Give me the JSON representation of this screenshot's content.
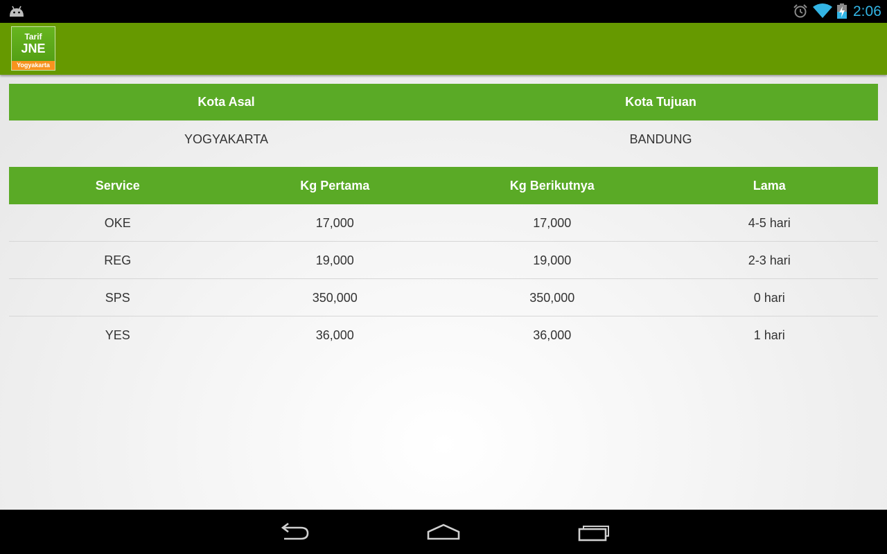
{
  "status_bar": {
    "time": "2:06",
    "accent_color": "#33b5e5",
    "icons": [
      "android-icon",
      "alarm-icon",
      "wifi-icon",
      "battery-charging-icon"
    ]
  },
  "action_bar": {
    "color": "#669900",
    "logo": {
      "top": "Tarif",
      "main": "JNE",
      "bottom": "Yogyakarta"
    }
  },
  "route": {
    "headers": [
      "Kota Asal",
      "Kota Tujuan"
    ],
    "values": [
      "YOGYAKARTA",
      "BANDUNG"
    ]
  },
  "tariff": {
    "header_color": "#5aaa26",
    "headers": [
      "Service",
      "Kg Pertama",
      "Kg Berikutnya",
      "Lama"
    ],
    "rows": [
      [
        "OKE",
        "17,000",
        "17,000",
        "4-5 hari"
      ],
      [
        "REG",
        "19,000",
        "19,000",
        "2-3 hari"
      ],
      [
        "SPS",
        "350,000",
        "350,000",
        "0 hari"
      ],
      [
        "YES",
        "36,000",
        "36,000",
        "1 hari"
      ]
    ]
  },
  "nav_bar": {
    "icons": [
      "back-icon",
      "home-icon",
      "recent-apps-icon"
    ]
  }
}
